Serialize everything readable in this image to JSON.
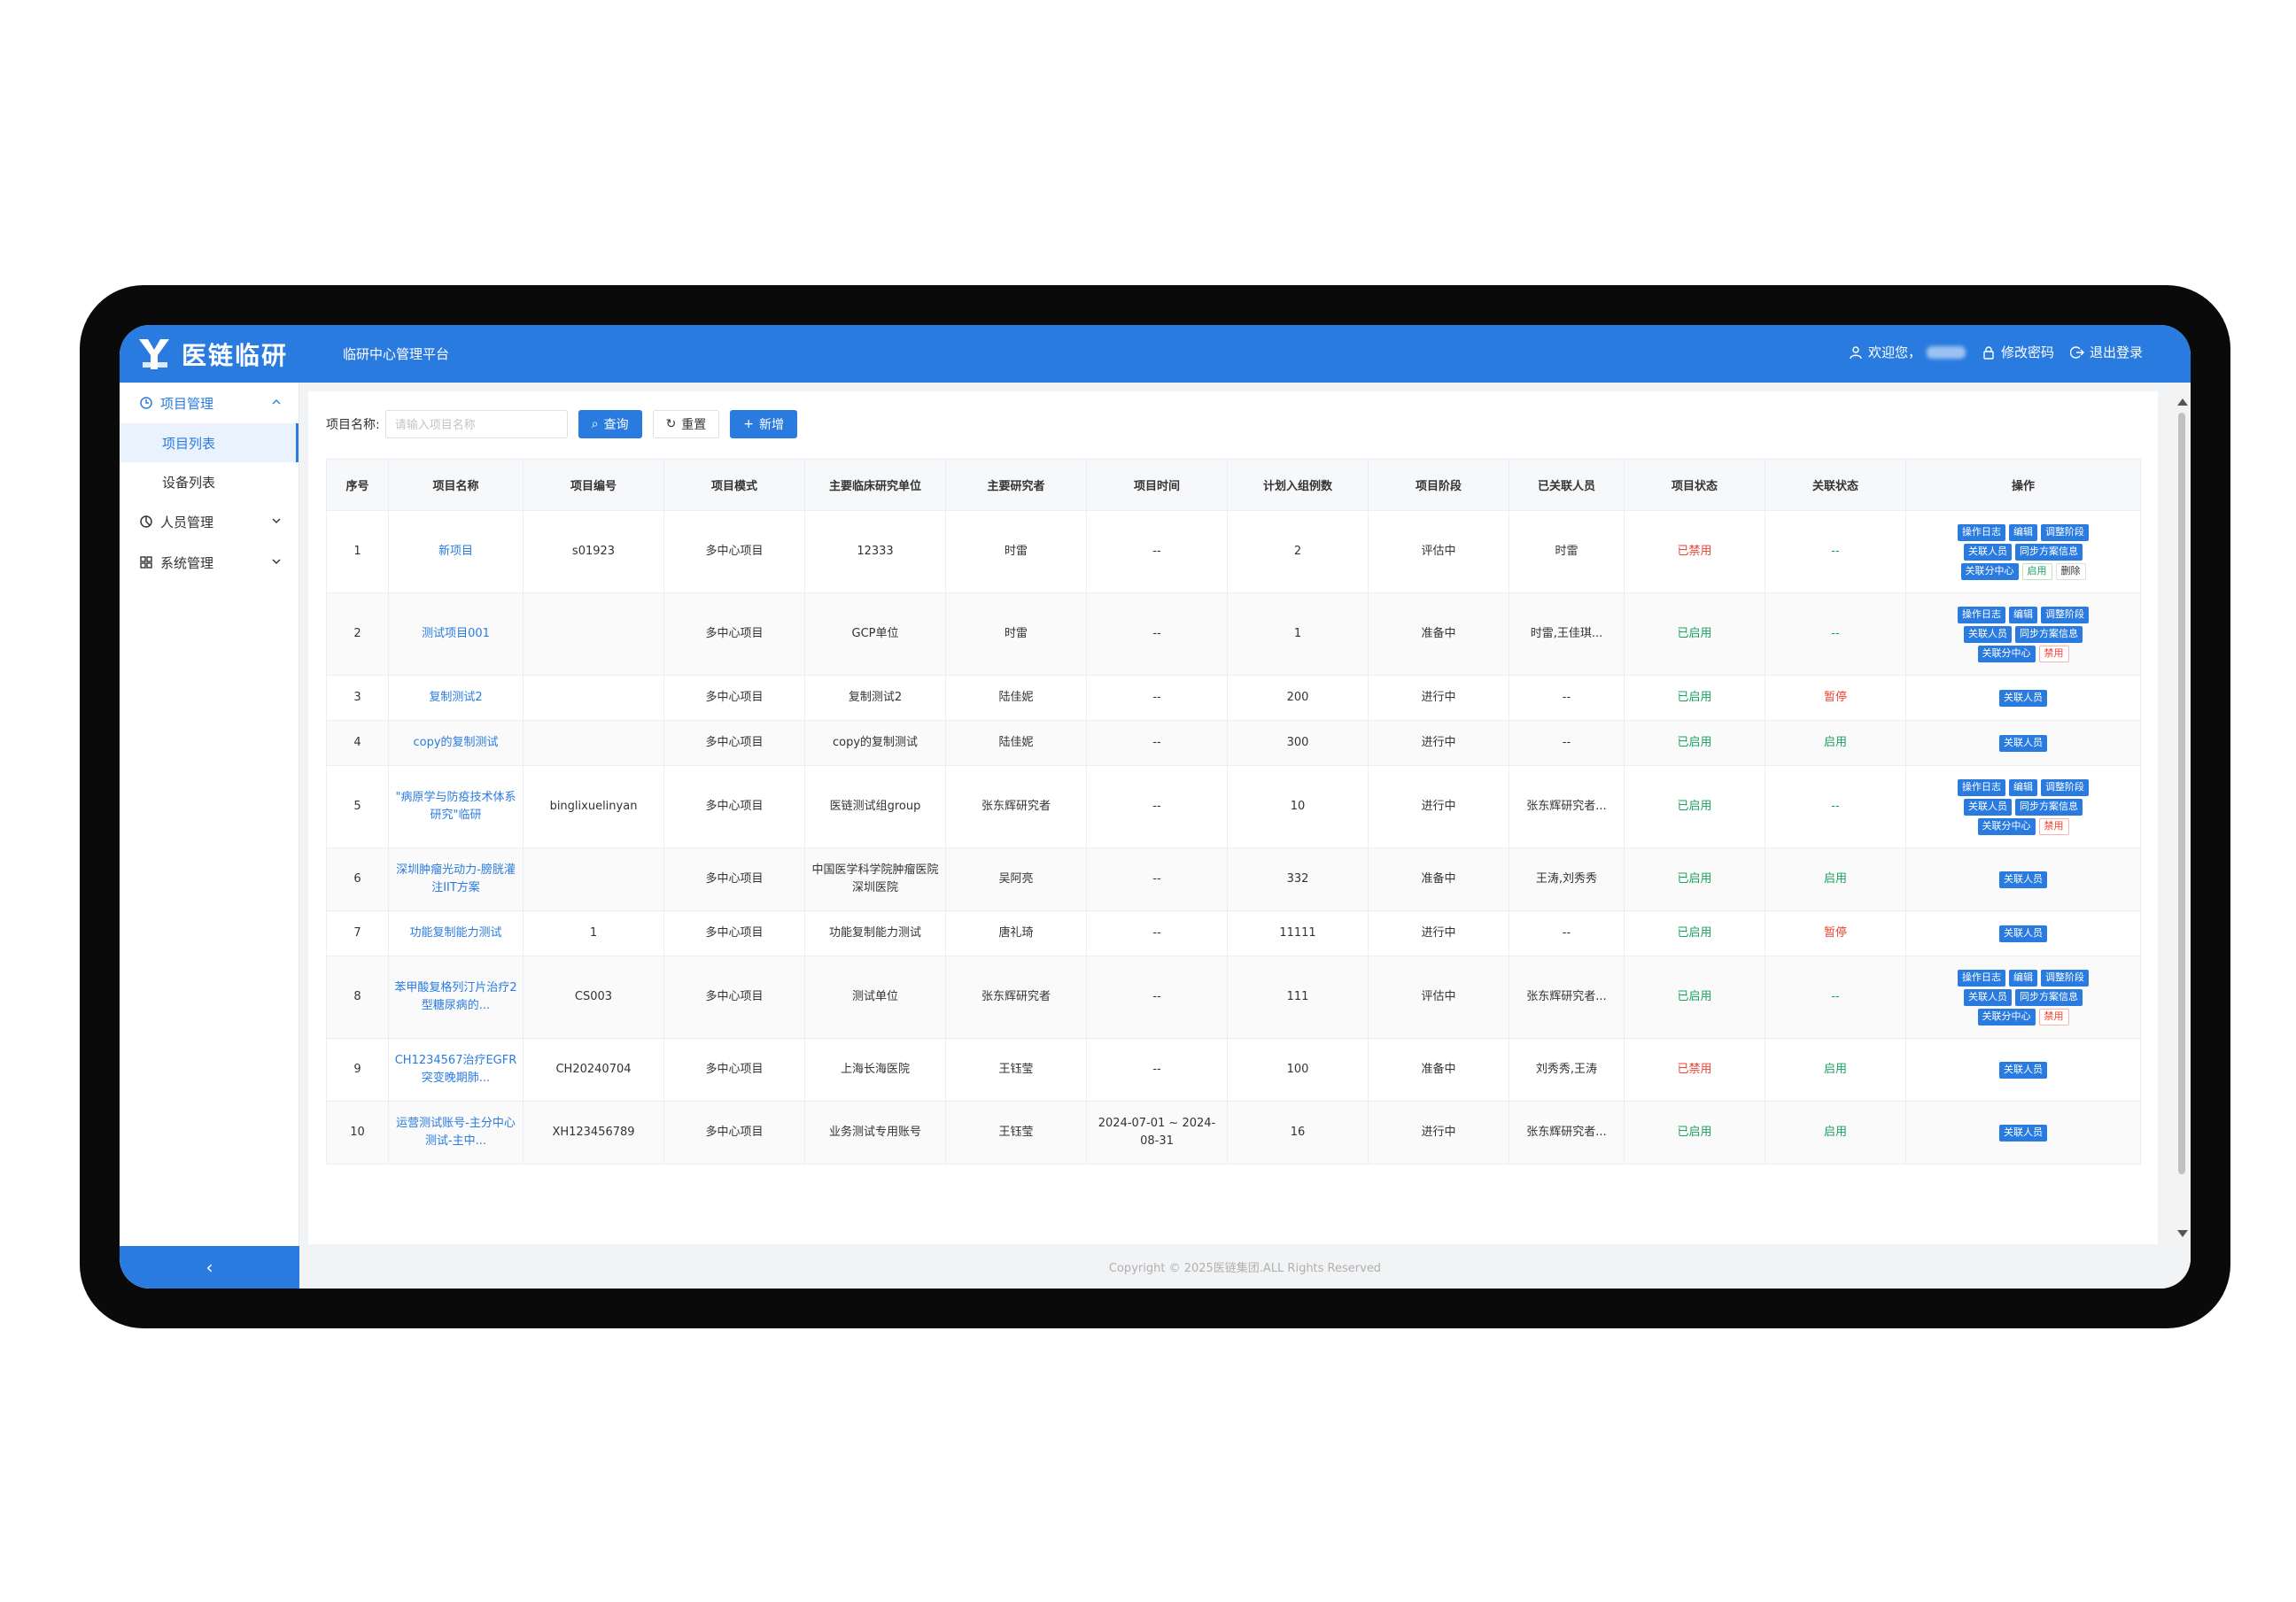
{
  "app": {
    "logo_text": "医链临研",
    "platform_name": "临研中心管理平台",
    "welcome": "欢迎您，",
    "change_password": "修改密码",
    "logout": "退出登录"
  },
  "sidebar": {
    "groups": [
      {
        "label": "项目管理",
        "icon": "project-icon",
        "expanded": true,
        "items": [
          {
            "label": "项目列表",
            "active": true
          },
          {
            "label": "设备列表",
            "active": false
          }
        ]
      },
      {
        "label": "人员管理",
        "icon": "people-icon",
        "expanded": false,
        "items": []
      },
      {
        "label": "系统管理",
        "icon": "system-icon",
        "expanded": false,
        "items": []
      }
    ],
    "collapse_label": "‹"
  },
  "search": {
    "label": "项目名称:",
    "placeholder": "请输入项目名称",
    "query_button": "查询",
    "reset_button": "重置",
    "add_button": "新增"
  },
  "table": {
    "columns": [
      "序号",
      "项目名称",
      "项目编号",
      "项目模式",
      "主要临床研究单位",
      "主要研究者",
      "项目时间",
      "计划入组例数",
      "项目阶段",
      "已关联人员",
      "项目状态",
      "关联状态",
      "操作"
    ],
    "rows": [
      {
        "no": "1",
        "name": "新项目",
        "code": "s01923",
        "mode": "多中心项目",
        "unit": "12333",
        "pi": "时雷",
        "time": "--",
        "plan": "2",
        "stage": "评估中",
        "members": "时雷",
        "status": "已禁用",
        "status_color": "red",
        "link": "--",
        "link_color": "green",
        "ops": "full",
        "toggle": "启用",
        "toggle_style": "green",
        "extra": "删除"
      },
      {
        "no": "2",
        "name": "测试项目001",
        "code": "",
        "mode": "多中心项目",
        "unit": "GCP单位",
        "pi": "时雷",
        "time": "--",
        "plan": "1",
        "stage": "准备中",
        "members": "时雷,王佳琪...",
        "status": "已启用",
        "status_color": "green",
        "link": "--",
        "link_color": "green",
        "ops": "full",
        "toggle": "禁用",
        "toggle_style": "red",
        "extra": ""
      },
      {
        "no": "3",
        "name": "复制测试2",
        "code": "",
        "mode": "多中心项目",
        "unit": "复制测试2",
        "pi": "陆佳妮",
        "time": "--",
        "plan": "200",
        "stage": "进行中",
        "members": "--",
        "status": "已启用",
        "status_color": "green",
        "link": "暂停",
        "link_color": "red",
        "ops": "single",
        "toggle": "",
        "toggle_style": "",
        "extra": ""
      },
      {
        "no": "4",
        "name": "copy的复制测试",
        "code": "",
        "mode": "多中心项目",
        "unit": "copy的复制测试",
        "pi": "陆佳妮",
        "time": "--",
        "plan": "300",
        "stage": "进行中",
        "members": "--",
        "status": "已启用",
        "status_color": "green",
        "link": "启用",
        "link_color": "green",
        "ops": "single",
        "toggle": "",
        "toggle_style": "",
        "extra": ""
      },
      {
        "no": "5",
        "name": "\"病原学与防疫技术体系研究\"临研",
        "code": "binglixuelinyan",
        "mode": "多中心项目",
        "unit": "医链测试组group",
        "pi": "张东辉研究者",
        "time": "--",
        "plan": "10",
        "stage": "进行中",
        "members": "张东辉研究者...",
        "status": "已启用",
        "status_color": "green",
        "link": "--",
        "link_color": "green",
        "ops": "full",
        "toggle": "禁用",
        "toggle_style": "red",
        "extra": ""
      },
      {
        "no": "6",
        "name": "深圳肿瘤光动力-膀胱灌注IIT方案",
        "code": "",
        "mode": "多中心项目",
        "unit": "中国医学科学院肿瘤医院深圳医院",
        "pi": "吴阿亮",
        "time": "--",
        "plan": "332",
        "stage": "准备中",
        "members": "王涛,刘秀秀",
        "status": "已启用",
        "status_color": "green",
        "link": "启用",
        "link_color": "green",
        "ops": "single",
        "toggle": "",
        "toggle_style": "",
        "extra": ""
      },
      {
        "no": "7",
        "name": "功能复制能力测试",
        "code": "1",
        "mode": "多中心项目",
        "unit": "功能复制能力测试",
        "pi": "唐礼琦",
        "time": "--",
        "plan": "11111",
        "stage": "进行中",
        "members": "--",
        "status": "已启用",
        "status_color": "green",
        "link": "暂停",
        "link_color": "red",
        "ops": "single",
        "toggle": "",
        "toggle_style": "",
        "extra": ""
      },
      {
        "no": "8",
        "name": "苯甲酸复格列汀片治疗2型糖尿病的...",
        "code": "CS003",
        "mode": "多中心项目",
        "unit": "测试单位",
        "pi": "张东辉研究者",
        "time": "--",
        "plan": "111",
        "stage": "评估中",
        "members": "张东辉研究者...",
        "status": "已启用",
        "status_color": "green",
        "link": "--",
        "link_color": "green",
        "ops": "full",
        "toggle": "禁用",
        "toggle_style": "red",
        "extra": ""
      },
      {
        "no": "9",
        "name": "CH1234567治疗EGFR突变晚期肺...",
        "code": "CH20240704",
        "mode": "多中心项目",
        "unit": "上海长海医院",
        "pi": "王钰莹",
        "time": "--",
        "plan": "100",
        "stage": "准备中",
        "members": "刘秀秀,王涛",
        "status": "已禁用",
        "status_color": "red",
        "link": "启用",
        "link_color": "green",
        "ops": "single",
        "toggle": "",
        "toggle_style": "",
        "extra": ""
      },
      {
        "no": "10",
        "name": "运营测试账号-主分中心测试-主中...",
        "code": "XH123456789",
        "mode": "多中心项目",
        "unit": "业务测试专用账号",
        "pi": "王钰莹",
        "time": "2024-07-01 ~ 2024-08-31",
        "plan": "16",
        "stage": "进行中",
        "members": "张东辉研究者...",
        "status": "已启用",
        "status_color": "green",
        "link": "启用",
        "link_color": "green",
        "ops": "single",
        "toggle": "",
        "toggle_style": "",
        "extra": ""
      }
    ],
    "op_labels": {
      "log": "操作日志",
      "edit": "编辑",
      "stage": "调整阶段",
      "members": "关联人员",
      "sync": "同步方案信息",
      "sub_center": "关联分中心"
    }
  },
  "footer": {
    "copyright": "Copyright © 2025医链集团.ALL Rights Reserved"
  },
  "colors": {
    "primary": "#2a7be0",
    "danger": "#f04134",
    "success": "#19a15f"
  }
}
